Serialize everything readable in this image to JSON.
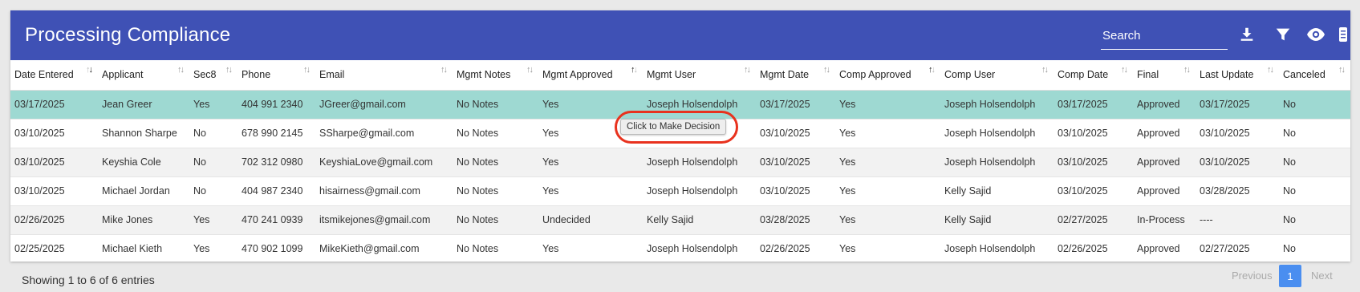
{
  "header": {
    "title": "Processing Compliance",
    "search_placeholder": "Search",
    "icons": [
      "download-icon",
      "filter-icon",
      "eye-icon",
      "columns-icon"
    ]
  },
  "columns": [
    {
      "label": "Date Entered",
      "sort": "desc"
    },
    {
      "label": "Applicant",
      "sort": "none"
    },
    {
      "label": "Sec8",
      "sort": "none"
    },
    {
      "label": "Phone",
      "sort": "none"
    },
    {
      "label": "Email",
      "sort": "none"
    },
    {
      "label": "Mgmt Notes",
      "sort": "none"
    },
    {
      "label": "Mgmt Approved",
      "sort": "asc"
    },
    {
      "label": "Mgmt User",
      "sort": "none"
    },
    {
      "label": "Mgmt Date",
      "sort": "none"
    },
    {
      "label": "Comp Approved",
      "sort": "asc"
    },
    {
      "label": "Comp User",
      "sort": "none"
    },
    {
      "label": "Comp Date",
      "sort": "none"
    },
    {
      "label": "Final",
      "sort": "none"
    },
    {
      "label": "Last Update",
      "sort": "none"
    },
    {
      "label": "Canceled",
      "sort": "none"
    }
  ],
  "rows": [
    [
      "03/17/2025",
      "Jean Greer",
      "Yes",
      "404 991 2340",
      "JGreer@gmail.com",
      "No Notes",
      "Yes",
      "Joseph Holsendolph",
      "03/17/2025",
      "Yes",
      "Joseph Holsendolph",
      "03/17/2025",
      "Approved",
      "03/17/2025",
      "No"
    ],
    [
      "03/10/2025",
      "Shannon Sharpe",
      "No",
      "678 990 2145",
      "SSharpe@gmail.com",
      "No Notes",
      "Yes",
      "",
      "03/10/2025",
      "Yes",
      "Joseph Holsendolph",
      "03/10/2025",
      "Approved",
      "03/10/2025",
      "No"
    ],
    [
      "03/10/2025",
      "Keyshia Cole",
      "No",
      "702 312 0980",
      "KeyshiaLove@gmail.com",
      "No Notes",
      "Yes",
      "Joseph Holsendolph",
      "03/10/2025",
      "Yes",
      "Joseph Holsendolph",
      "03/10/2025",
      "Approved",
      "03/10/2025",
      "No"
    ],
    [
      "03/10/2025",
      "Michael Jordan",
      "No",
      "404 987 2340",
      "hisairness@gmail.com",
      "No Notes",
      "Yes",
      "Joseph Holsendolph",
      "03/10/2025",
      "Yes",
      "Kelly Sajid",
      "03/10/2025",
      "Approved",
      "03/28/2025",
      "No"
    ],
    [
      "02/26/2025",
      "Mike Jones",
      "Yes",
      "470 241 0939",
      "itsmikejones@gmail.com",
      "No Notes",
      "Undecided",
      "Kelly Sajid",
      "03/28/2025",
      "Yes",
      "Kelly Sajid",
      "02/27/2025",
      "In-Process",
      "----",
      "No"
    ],
    [
      "02/25/2025",
      "Michael Kieth",
      "Yes",
      "470 902 1099",
      "MikeKieth@gmail.com",
      "No Notes",
      "Yes",
      "Joseph Holsendolph",
      "02/26/2025",
      "Yes",
      "Joseph Holsendolph",
      "02/26/2025",
      "Approved",
      "02/27/2025",
      "No"
    ]
  ],
  "selected_row": 0,
  "tooltip": "Click to Make Decision",
  "footer": {
    "info": "Showing 1 to 6 of 6 entries",
    "prev": "Previous",
    "page": "1",
    "next": "Next"
  },
  "colors": {
    "header_bg": "#3f51b5",
    "selected_row": "#9ed9d2",
    "annotation_ring": "#e8321e",
    "page_active": "#4a8ef0"
  }
}
